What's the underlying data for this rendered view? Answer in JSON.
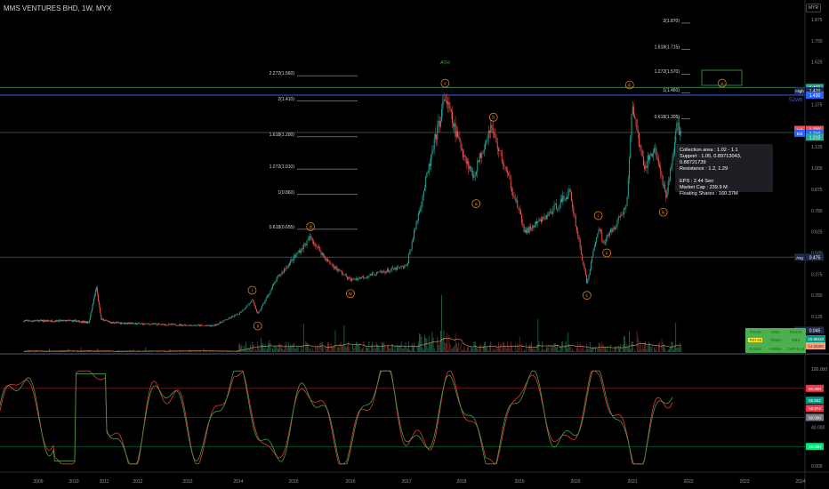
{
  "header": {
    "title": "MMS VENTURES BHD, 1W, MYX",
    "currency": "MYR"
  },
  "info_box": {
    "lines": [
      "Collection area : 1.02 - 1.1",
      "Support : 1.05,  0.89713043,  0.88721739",
      "Resistance : 1.2,  1.29",
      "",
      "EPS : 2.44 Sen",
      "Market Cap : 239.9 M",
      "Floating Shares : 160.37M"
    ]
  },
  "indicator_table": {
    "cells": [
      "PSAR",
      "EMA",
      "MACD",
      "RSI 62",
      "TEMA",
      "OBV",
      "KAMA",
      "VWMA",
      "CHP 0.14"
    ]
  },
  "colors": {
    "up": "#26a69a",
    "down": "#ef5350",
    "wave": "#f7931a",
    "fib": "#cccccc",
    "high_line": "#2e7d52",
    "wh_line": "#2962ff"
  },
  "chart_data": {
    "type": "candlestick",
    "title": "MMS VENTURES BHD, 1W, MYX",
    "x_ticks": [
      "2009",
      "2010",
      "2011",
      "2012",
      "2013",
      "2014",
      "2015",
      "2016",
      "2017",
      "2018",
      "2019",
      "2020",
      "2021",
      "2022",
      "2023",
      "2024"
    ],
    "y_ticks": [
      "1.875",
      "1.750",
      "1.625",
      "1.375",
      "1.125",
      "1.000",
      "0.875",
      "0.750",
      "0.625",
      "0.500",
      "0.375",
      "0.250",
      "0.125"
    ],
    "ylim": [
      0.04,
      1.95
    ],
    "price_path": [
      [
        2008.6,
        0.1
      ],
      [
        2010.0,
        0.1
      ],
      [
        2010.5,
        0.09
      ],
      [
        2010.75,
        0.3
      ],
      [
        2010.9,
        0.11
      ],
      [
        2011.2,
        0.09
      ],
      [
        2013.5,
        0.07
      ],
      [
        2014.0,
        0.14
      ],
      [
        2014.25,
        0.22
      ],
      [
        2014.35,
        0.14
      ],
      [
        2014.7,
        0.35
      ],
      [
        2015.3,
        0.59
      ],
      [
        2015.6,
        0.45
      ],
      [
        2016.0,
        0.34
      ],
      [
        2016.6,
        0.39
      ],
      [
        2017.0,
        0.42
      ],
      [
        2017.3,
        0.85
      ],
      [
        2017.7,
        1.42
      ],
      [
        2017.9,
        1.2
      ],
      [
        2018.2,
        0.95
      ],
      [
        2018.5,
        1.25
      ],
      [
        2018.9,
        0.85
      ],
      [
        2019.1,
        0.62
      ],
      [
        2019.5,
        0.72
      ],
      [
        2019.9,
        0.86
      ],
      [
        2020.2,
        0.32
      ],
      [
        2020.4,
        0.65
      ],
      [
        2020.5,
        0.56
      ],
      [
        2020.9,
        0.78
      ],
      [
        2021.0,
        1.38
      ],
      [
        2021.2,
        1.0
      ],
      [
        2021.4,
        1.12
      ],
      [
        2021.6,
        0.82
      ],
      [
        2021.8,
        1.25
      ],
      [
        2021.87,
        1.21
      ]
    ],
    "price_tags": [
      {
        "label": "",
        "value": "1.475",
        "price": 1.475,
        "color": "#26a69a"
      },
      {
        "label": "High",
        "value": "1.470",
        "price": 1.455,
        "color": "#1e2a4a"
      },
      {
        "label": "",
        "value": "1.430",
        "price": 1.43,
        "color": "#2962ff"
      },
      {
        "label": "Ask",
        "value": "1.220",
        "price": 1.228,
        "color": "#ef5350"
      },
      {
        "label": "Bid",
        "value": "1.210",
        "price": 1.205,
        "color": "#2962ff"
      },
      {
        "label": "",
        "value": "1.210",
        "price": 1.182,
        "color": "#26a69a"
      },
      {
        "label": "Avg",
        "value": "0.475",
        "price": 0.475,
        "color": "#1e2a4a"
      },
      {
        "label": "Low",
        "value": "0.045",
        "price": 0.045,
        "color": "#1e2a4a"
      }
    ],
    "hlines": [
      {
        "price": 1.475,
        "color": "#2e7d52"
      },
      {
        "price": 1.43,
        "color": "#2962ff"
      },
      {
        "price": 1.21,
        "color": "#2c4a3c"
      },
      {
        "price": 0.475,
        "color": "#444"
      }
    ],
    "wh_label": "52wh",
    "ath_label": "ATH",
    "fib_left": [
      {
        "text": "2.272(1.560)",
        "price": 1.56
      },
      {
        "text": "2(1.410)",
        "price": 1.41
      },
      {
        "text": "1.618(1.200)",
        "price": 1.2
      },
      {
        "text": "1.272(1.010)",
        "price": 1.01
      },
      {
        "text": "1(0.860)",
        "price": 0.86
      },
      {
        "text": "0.618(0.655)",
        "price": 0.655
      }
    ],
    "fib_right": [
      {
        "text": "2(1.870)",
        "price": 1.87
      },
      {
        "text": "1.618(1.715)",
        "price": 1.715
      },
      {
        "text": "1.272(1.570)",
        "price": 1.57
      },
      {
        "text": "1(1.460)",
        "price": 1.46
      },
      {
        "text": "0.618(1.305)",
        "price": 1.305
      }
    ],
    "waves": [
      {
        "t": "i",
        "x": 2014.25,
        "p": 0.28
      },
      {
        "t": "ii",
        "x": 2014.35,
        "p": 0.07
      },
      {
        "t": "iii",
        "x": 2015.3,
        "p": 0.655
      },
      {
        "t": "iv",
        "x": 2016.0,
        "p": 0.26
      },
      {
        "t": "v",
        "x": 2017.7,
        "p": 1.5
      },
      {
        "t": "a",
        "x": 2018.25,
        "p": 0.79
      },
      {
        "t": "b",
        "x": 2018.55,
        "p": 1.3
      },
      {
        "t": "c",
        "x": 2020.2,
        "p": 0.25
      },
      {
        "t": "i",
        "x": 2020.4,
        "p": 0.72
      },
      {
        "t": "ii",
        "x": 2020.55,
        "p": 0.5
      },
      {
        "t": "iii",
        "x": 2020.95,
        "p": 1.49
      },
      {
        "t": "iv",
        "x": 2021.55,
        "p": 0.74
      },
      {
        "t": "v",
        "x": 2022.6,
        "p": 1.5
      }
    ],
    "rsi": {
      "y_ticks": [
        "100.000",
        "40.000",
        "0.000"
      ],
      "levels": [
        {
          "value": 80,
          "label": "80.000",
          "color": "#f23645"
        },
        {
          "value": 50,
          "label": "50.000",
          "color": "#787b86"
        },
        {
          "value": 20,
          "label": "20.000",
          "color": "#00e676"
        }
      ],
      "last": [
        {
          "label": "65.552",
          "color": "#089981"
        },
        {
          "label": "62.974",
          "color": "#f23645"
        }
      ],
      "ylim": [
        0,
        100
      ]
    },
    "volume_tags": [
      {
        "label": "15.991M",
        "color": "#089981"
      },
      {
        "label": "14.563M",
        "color": "#ff9f7a"
      }
    ]
  }
}
